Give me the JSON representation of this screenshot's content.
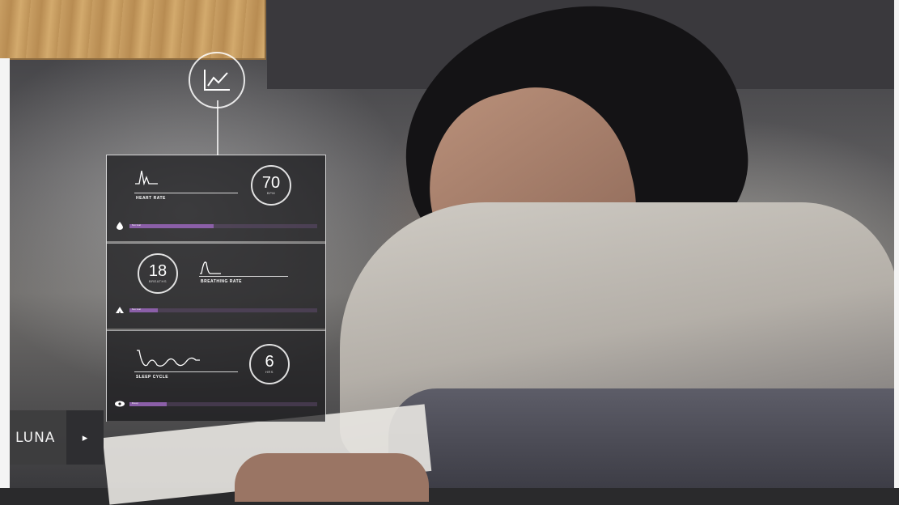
{
  "brand": {
    "name": "LUNA",
    "next_icon": "chevron-right-icon"
  },
  "overlay": {
    "top_icon": "line-chart-icon",
    "metrics": [
      {
        "label": "HEART RATE",
        "value": "70",
        "unit": "BPM",
        "graph_icon": "heart-rate-graph",
        "status_icon": "drop-icon",
        "status_text": "Normal",
        "level": 0.45
      },
      {
        "label": "BREATHING RATE",
        "value": "18",
        "unit": "BREATHS",
        "graph_icon": "breathing-wave-graph",
        "status_icon": "lungs-icon",
        "status_text": "Normal",
        "level": 0.15
      },
      {
        "label": "SLEEP CYCLE",
        "value": "6",
        "unit": "HRS",
        "graph_icon": "sleep-cycle-graph",
        "status_icon": "eye-icon",
        "status_text": "Deep",
        "level": 0.2
      }
    ]
  },
  "colors": {
    "accent": "#8b5fa8",
    "panel": "#19191c",
    "text": "#ffffff"
  }
}
